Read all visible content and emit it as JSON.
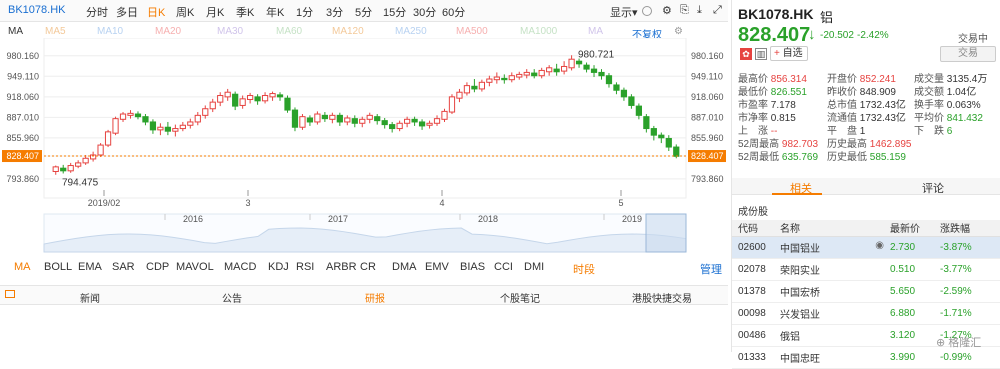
{
  "tabs": {
    "code": "BK1078.HK",
    "items": [
      "分时",
      "多日",
      "日K",
      "周K",
      "月K",
      "季K",
      "年K",
      "1分",
      "3分",
      "5分",
      "15分",
      "30分",
      "60分"
    ],
    "active": "日K",
    "display_label": "显示",
    "display_arrow": "▾"
  },
  "ma": {
    "label": "MA",
    "items": [
      "MA5",
      "MA10",
      "MA20",
      "MA30",
      "MA60",
      "MA120",
      "MA250",
      "MA500",
      "MA1000",
      "MA"
    ],
    "adjust": "不复权"
  },
  "chart_data": {
    "type": "candlestick",
    "y_ticks": [
      "980.160",
      "949.110",
      "918.060",
      "887.010",
      "855.960",
      "828.407",
      "793.860"
    ],
    "y_ticks_right": [
      "980.160",
      "949.110",
      "918.060",
      "887.010",
      "855.960",
      "828.407",
      "793.860"
    ],
    "x_ticks": [
      "2019/02",
      "3",
      "4",
      "5"
    ],
    "high_label": "980.721",
    "low_label": "794.475",
    "current": 828.407,
    "ylim": [
      780,
      995
    ],
    "candles": [
      [
        805,
        812,
        800,
        814
      ],
      [
        810,
        806,
        802,
        815
      ],
      [
        806,
        814,
        803,
        818
      ],
      [
        813,
        818,
        810,
        822
      ],
      [
        818,
        825,
        815,
        830
      ],
      [
        824,
        830,
        820,
        835
      ],
      [
        830,
        845,
        827,
        848
      ],
      [
        845,
        865,
        842,
        868
      ],
      [
        863,
        885,
        860,
        888
      ],
      [
        884,
        892,
        880,
        895
      ],
      [
        890,
        893,
        885,
        898
      ],
      [
        892,
        888,
        884,
        896
      ],
      [
        888,
        880,
        875,
        892
      ],
      [
        880,
        868,
        862,
        884
      ],
      [
        868,
        872,
        860,
        878
      ],
      [
        872,
        866,
        860,
        880
      ],
      [
        866,
        870,
        858,
        876
      ],
      [
        870,
        875,
        866,
        880
      ],
      [
        875,
        880,
        870,
        885
      ],
      [
        880,
        890,
        875,
        895
      ],
      [
        890,
        900,
        885,
        905
      ],
      [
        900,
        910,
        895,
        915
      ],
      [
        910,
        920,
        904,
        925
      ],
      [
        918,
        925,
        912,
        930
      ],
      [
        922,
        904,
        898,
        926
      ],
      [
        905,
        915,
        900,
        920
      ],
      [
        914,
        920,
        908,
        924
      ],
      [
        918,
        912,
        906,
        922
      ],
      [
        912,
        920,
        908,
        925
      ],
      [
        918,
        923,
        912,
        926
      ],
      [
        921,
        918,
        912,
        925
      ],
      [
        916,
        898,
        894,
        920
      ],
      [
        898,
        872,
        866,
        902
      ],
      [
        872,
        888,
        868,
        892
      ],
      [
        886,
        880,
        874,
        890
      ],
      [
        880,
        892,
        876,
        896
      ],
      [
        890,
        885,
        880,
        895
      ],
      [
        884,
        890,
        878,
        894
      ],
      [
        890,
        880,
        874,
        894
      ],
      [
        880,
        886,
        875,
        890
      ],
      [
        885,
        878,
        872,
        890
      ],
      [
        878,
        884,
        872,
        888
      ],
      [
        884,
        890,
        878,
        894
      ],
      [
        888,
        882,
        876,
        892
      ],
      [
        882,
        876,
        870,
        886
      ],
      [
        876,
        870,
        864,
        880
      ],
      [
        870,
        878,
        866,
        882
      ],
      [
        878,
        884,
        872,
        888
      ],
      [
        884,
        880,
        874,
        888
      ],
      [
        880,
        874,
        868,
        884
      ],
      [
        875,
        878,
        870,
        882
      ],
      [
        878,
        885,
        874,
        890
      ],
      [
        884,
        896,
        880,
        900
      ],
      [
        895,
        918,
        892,
        922
      ],
      [
        916,
        925,
        910,
        930
      ],
      [
        924,
        935,
        920,
        940
      ],
      [
        934,
        930,
        925,
        945
      ],
      [
        930,
        940,
        926,
        944
      ],
      [
        940,
        945,
        934,
        950
      ],
      [
        944,
        948,
        938,
        955
      ],
      [
        946,
        944,
        938,
        952
      ],
      [
        944,
        950,
        940,
        955
      ],
      [
        948,
        952,
        944,
        956
      ],
      [
        951,
        955,
        946,
        960
      ],
      [
        954,
        950,
        946,
        960
      ],
      [
        950,
        958,
        946,
        962
      ],
      [
        956,
        962,
        950,
        966
      ],
      [
        960,
        956,
        950,
        968
      ],
      [
        957,
        964,
        952,
        972
      ],
      [
        962,
        975,
        958,
        981
      ],
      [
        972,
        968,
        962,
        976
      ],
      [
        966,
        960,
        955,
        970
      ],
      [
        960,
        955,
        948,
        966
      ],
      [
        955,
        950,
        944,
        960
      ],
      [
        950,
        938,
        932,
        954
      ],
      [
        936,
        928,
        922,
        940
      ],
      [
        928,
        918,
        912,
        932
      ],
      [
        918,
        905,
        900,
        922
      ],
      [
        904,
        890,
        884,
        908
      ],
      [
        888,
        870,
        864,
        892
      ],
      [
        870,
        860,
        852,
        874
      ],
      [
        860,
        856,
        848,
        864
      ],
      [
        855,
        842,
        836,
        860
      ],
      [
        842,
        828,
        825,
        846
      ]
    ]
  },
  "time_axis": [
    "2016",
    "2017",
    "2018",
    "2019"
  ],
  "indicators": {
    "items": [
      "MA",
      "BOLL",
      "EMA",
      "SAR",
      "CDP",
      "MAVOL",
      "MACD",
      "KDJ",
      "RSI",
      "ARBR",
      "CR",
      "DMA",
      "EMV",
      "BIAS",
      "CCI",
      "DMI"
    ],
    "active": "MA",
    "timeshare": "时段",
    "manage": "管理"
  },
  "bottom_tabs": {
    "items": [
      "新闻",
      "公告",
      "研报",
      "个股笔记",
      "港股快捷交易"
    ],
    "active": "研报"
  },
  "quote": {
    "code": "BK1078.HK",
    "name": "铝",
    "price": "828.407",
    "arrow": "↓",
    "change": "-20.502",
    "change_pct": "-2.42%",
    "status": "交易中",
    "trade_btn": "交易",
    "watch_label": "自选",
    "watch_plus": "+"
  },
  "stats": [
    {
      "l": "最高价",
      "v": "856.314",
      "c": "up"
    },
    {
      "l": "开盘价",
      "v": "852.241",
      "c": "up"
    },
    {
      "l": "成交量",
      "v": "3135.4万",
      "c": ""
    },
    {
      "l": "最低价",
      "v": "826.551",
      "c": "down"
    },
    {
      "l": "昨收价",
      "v": "848.909",
      "c": ""
    },
    {
      "l": "成交额",
      "v": "1.04亿",
      "c": ""
    },
    {
      "l": "市盈率",
      "v": "7.178",
      "c": ""
    },
    {
      "l": "总市值",
      "v": "1732.43亿",
      "c": ""
    },
    {
      "l": "换手率",
      "v": "0.063%",
      "c": ""
    },
    {
      "l": "市净率",
      "v": "0.815",
      "c": ""
    },
    {
      "l": "流通值",
      "v": "1732.43亿",
      "c": ""
    },
    {
      "l": "平均价",
      "v": "841.432",
      "c": "down"
    },
    {
      "l": "上　涨",
      "v": "--",
      "c": "up"
    },
    {
      "l": "平　盘",
      "v": "1",
      "c": ""
    },
    {
      "l": "下　跌",
      "v": "6",
      "c": "down"
    },
    {
      "l": "52周最高",
      "v": "982.703",
      "c": "up"
    },
    {
      "l": "历史最高",
      "v": "1462.895",
      "c": "up"
    },
    {
      "l": "",
      "v": "",
      "c": ""
    },
    {
      "l": "52周最低",
      "v": "635.769",
      "c": "down"
    },
    {
      "l": "历史最低",
      "v": "585.159",
      "c": "down"
    },
    {
      "l": "",
      "v": "",
      "c": ""
    }
  ],
  "right_tabs": [
    "相关",
    "评论"
  ],
  "constituents": {
    "title": "成份股",
    "headers": [
      "代码",
      "名称",
      "最新价",
      "涨跌幅"
    ],
    "rows": [
      {
        "code": "02600",
        "name": "中国铝业",
        "price": "2.730",
        "pct": "-3.87%"
      },
      {
        "code": "02078",
        "name": "荣阳实业",
        "price": "0.510",
        "pct": "-3.77%"
      },
      {
        "code": "01378",
        "name": "中国宏桥",
        "price": "5.650",
        "pct": "-2.59%"
      },
      {
        "code": "00098",
        "name": "兴发铝业",
        "price": "6.880",
        "pct": "-1.71%"
      },
      {
        "code": "00486",
        "name": "俄铝",
        "price": "3.120",
        "pct": "-1.27%"
      },
      {
        "code": "01333",
        "name": "中国忠旺",
        "price": "3.990",
        "pct": "-0.99%"
      }
    ]
  },
  "watermark": "格隆汇",
  "colors": {
    "up": "#e64340",
    "down": "#2aa12a",
    "accent": "#f57c00",
    "link": "#1a6fd1"
  }
}
